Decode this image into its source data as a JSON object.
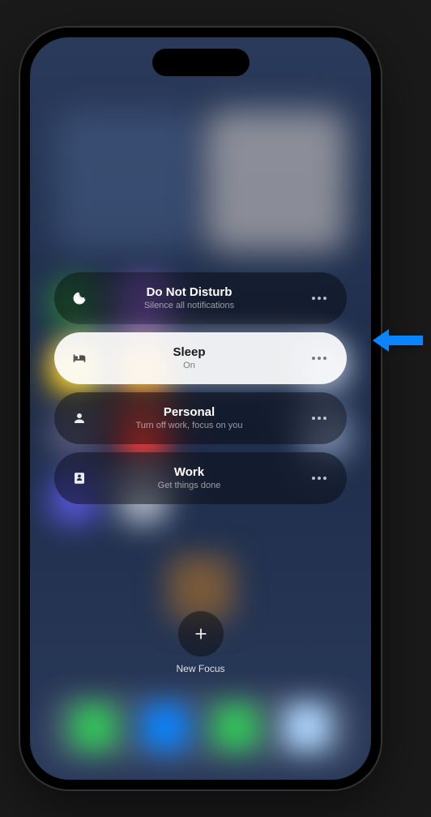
{
  "focus_modes": [
    {
      "title": "Do Not Disturb",
      "subtitle": "Silence all notifications",
      "icon": "moon",
      "active": false
    },
    {
      "title": "Sleep",
      "subtitle": "On",
      "icon": "bed",
      "active": true
    },
    {
      "title": "Personal",
      "subtitle": "Turn off work, focus on you",
      "icon": "person",
      "active": false
    },
    {
      "title": "Work",
      "subtitle": "Get things done",
      "icon": "badge",
      "active": false
    }
  ],
  "new_focus_label": "New Focus"
}
